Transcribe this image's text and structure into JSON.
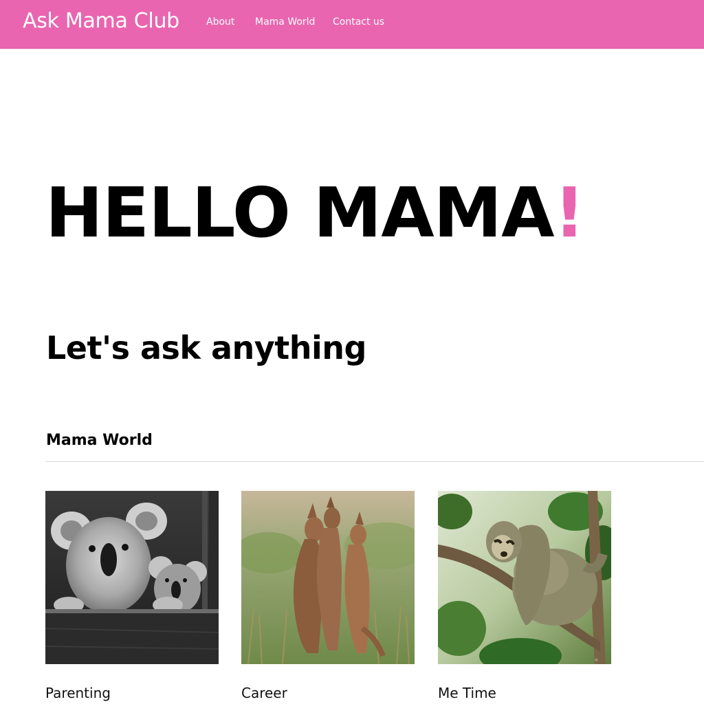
{
  "header": {
    "brand": "Ask Mama Club",
    "nav": [
      {
        "label": "About"
      },
      {
        "label": "Mama World"
      },
      {
        "label": "Contact us"
      }
    ],
    "bg_color": "#e965b0"
  },
  "hero": {
    "title": "HELLO MAMA",
    "exclamation": "!",
    "accent_color": "#e965b0"
  },
  "subtitle": "Let's ask anything",
  "section": {
    "title": "Mama World",
    "cards": [
      {
        "label": "Parenting",
        "image": "koala-mother-and-baby-photo"
      },
      {
        "label": "Career",
        "image": "kangaroos-photo"
      },
      {
        "label": "Me Time",
        "image": "sloth-on-branch-photo"
      }
    ]
  }
}
